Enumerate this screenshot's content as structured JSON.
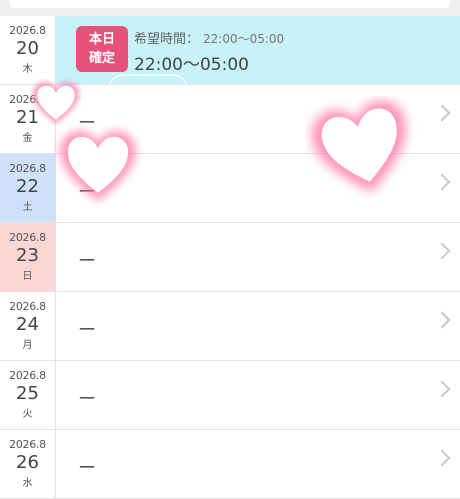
{
  "rows": [
    {
      "year_month": "2026.8",
      "day": "20",
      "weekday": "木",
      "status": "today"
    },
    {
      "year_month": "2026.8",
      "day": "21",
      "weekday": "金",
      "value": "ー"
    },
    {
      "year_month": "2026.8",
      "day": "22",
      "weekday": "土",
      "value": "ー"
    },
    {
      "year_month": "2026.8",
      "day": "23",
      "weekday": "日",
      "value": "ー"
    },
    {
      "year_month": "2026.8",
      "day": "24",
      "weekday": "月",
      "value": "ー"
    },
    {
      "year_month": "2026.8",
      "day": "25",
      "weekday": "火",
      "value": "ー"
    },
    {
      "year_month": "2026.8",
      "day": "26",
      "weekday": "水",
      "value": "ー"
    }
  ],
  "today": {
    "badge_line1": "本日",
    "badge_line2": "確定",
    "request_label": "希望時間：",
    "request_value": "22:00〜05:00",
    "confirmed_time": "22:00〜05:00"
  },
  "colors": {
    "today_bg": "#c6f2f8",
    "badge": "#e8527a",
    "saturday": "#cfe0fb",
    "sunday": "#fbd6d4"
  },
  "icons": {
    "row_arrow": "chevron-right-icon",
    "decoration": "heart-icon"
  }
}
